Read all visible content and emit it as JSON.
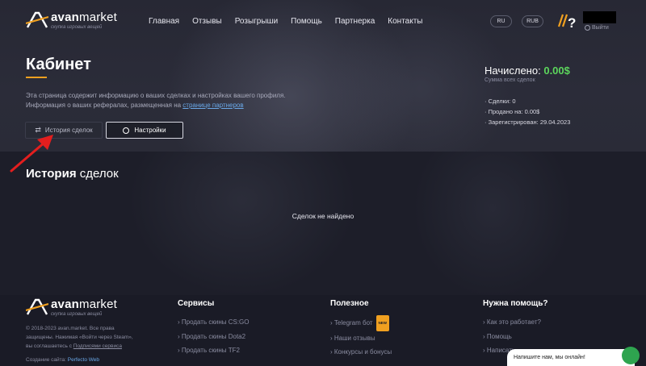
{
  "header": {
    "logo_name_bold": "avan",
    "logo_name_rest": "market",
    "logo_tagline": "скупка игровых вещей",
    "nav": [
      "Главная",
      "Отзывы",
      "Розыгрыши",
      "Помощь",
      "Партнерка",
      "Контакты"
    ],
    "lang": "RU",
    "currency": "RUB",
    "logout": "Выйти"
  },
  "cabinet": {
    "title": "Кабинет",
    "desc_line1": "Эта страница содержит информацию о ваших сделках и настройках вашего профиля.",
    "desc_line2_prefix": "Информация о ваших рефералах, размещенная на ",
    "desc_link": "странице партнеров",
    "tab_history": "История сделок",
    "tab_settings": "Настройки",
    "accrued_label": "Начислено:",
    "accrued_value": "0.00$",
    "accrued_sub": "Сумма всех сделок",
    "stats": [
      "Сделки: 0",
      "Продано на: 0.00$",
      "Зарегистрирован: 29.04.2023"
    ]
  },
  "history": {
    "title_bold": "История",
    "title_rest": "сделок",
    "empty": "Сделок не найдено"
  },
  "footer": {
    "copy_line1": "© 2018-2023 avan.market. Все права",
    "copy_line2": "защищены. Нажимая «Войти через Steam»,",
    "copy_line3_prefix": "вы соглашаетесь с ",
    "copy_terms": "Подписями сервиса",
    "copy_created_prefix": "Создание сайта: ",
    "copy_created_link": "Perfecto Web",
    "services_title": "Сервисы",
    "services": [
      "Продать скины CS:GO",
      "Продать скины Dota2",
      "Продать скины TF2"
    ],
    "useful_title": "Полезное",
    "useful": [
      "Telegram бот",
      "Наши отзывы",
      "Конкурсы и бонусы"
    ],
    "useful_badge": "NEW",
    "help_title": "Нужна помощь?",
    "help": [
      "Как это работает?",
      "Помощь",
      "Написать"
    ],
    "chat": "Напишите нам, мы онлайн!"
  },
  "colors": {
    "accent": "#f0a020",
    "green": "#5cd65c",
    "link": "#6aa8e8"
  }
}
